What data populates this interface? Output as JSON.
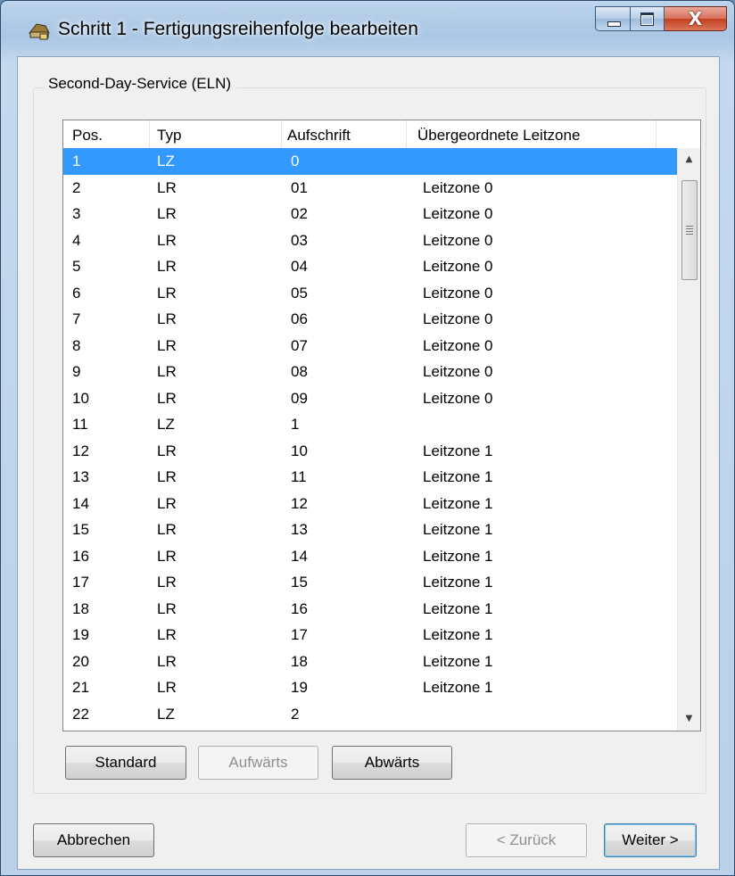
{
  "window": {
    "title": "Schritt 1 - Fertigungsreihenfolge bearbeiten",
    "icon": "wizard-hat-icon",
    "caption_buttons": {
      "minimize": "",
      "maximize": "",
      "close": "X"
    }
  },
  "group": {
    "label": "Second-Day-Service (ELN)"
  },
  "table": {
    "columns": [
      "Pos.",
      "Typ",
      "Aufschrift",
      "Übergeordnete Leitzone"
    ],
    "rows": [
      [
        "1",
        "LZ",
        "0",
        ""
      ],
      [
        "2",
        "LR",
        "01",
        "Leitzone 0"
      ],
      [
        "3",
        "LR",
        "02",
        "Leitzone 0"
      ],
      [
        "4",
        "LR",
        "03",
        "Leitzone 0"
      ],
      [
        "5",
        "LR",
        "04",
        "Leitzone 0"
      ],
      [
        "6",
        "LR",
        "05",
        "Leitzone 0"
      ],
      [
        "7",
        "LR",
        "06",
        "Leitzone 0"
      ],
      [
        "8",
        "LR",
        "07",
        "Leitzone 0"
      ],
      [
        "9",
        "LR",
        "08",
        "Leitzone 0"
      ],
      [
        "10",
        "LR",
        "09",
        "Leitzone 0"
      ],
      [
        "11",
        "LZ",
        "1",
        ""
      ],
      [
        "12",
        "LR",
        "10",
        "Leitzone 1"
      ],
      [
        "13",
        "LR",
        "11",
        "Leitzone 1"
      ],
      [
        "14",
        "LR",
        "12",
        "Leitzone 1"
      ],
      [
        "15",
        "LR",
        "13",
        "Leitzone 1"
      ],
      [
        "16",
        "LR",
        "14",
        "Leitzone 1"
      ],
      [
        "17",
        "LR",
        "15",
        "Leitzone 1"
      ],
      [
        "18",
        "LR",
        "16",
        "Leitzone 1"
      ],
      [
        "19",
        "LR",
        "17",
        "Leitzone 1"
      ],
      [
        "20",
        "LR",
        "18",
        "Leitzone 1"
      ],
      [
        "21",
        "LR",
        "19",
        "Leitzone 1"
      ],
      [
        "22",
        "LZ",
        "2",
        ""
      ]
    ],
    "selected_row": 0
  },
  "list_buttons": {
    "standard": "Standard",
    "aufwaerts": "Aufwärts",
    "abwaerts": "Abwärts"
  },
  "footer_buttons": {
    "cancel": "Abbrechen",
    "back": "< Zurück",
    "next": "Weiter >"
  },
  "colors": {
    "selection": "#3399ff",
    "dialog_bg": "#f0f0f0",
    "title_glass": "#a9c6e4",
    "close_red": "#c3401f"
  }
}
